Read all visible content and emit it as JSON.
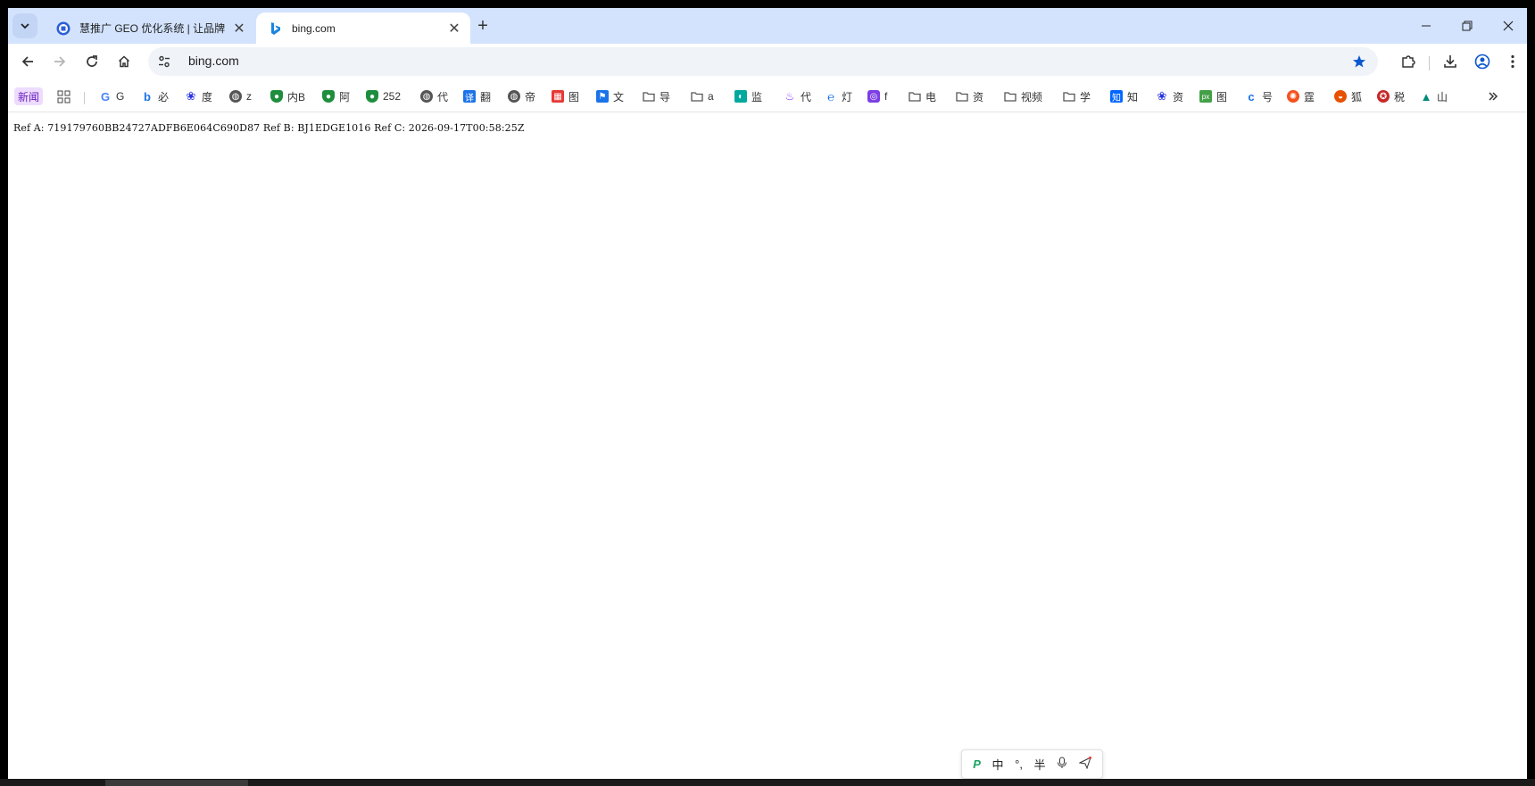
{
  "tabs": [
    {
      "title": "慧推广 GEO 优化系统 | 让品牌",
      "active": false
    },
    {
      "title": "bing.com",
      "active": true
    }
  ],
  "address": {
    "url": "bing.com"
  },
  "bookmarks": [
    {
      "label": "新闻",
      "icon": "news-badge"
    },
    {
      "label": "",
      "icon": "apps-grid-icon"
    },
    {
      "label": "G",
      "icon": "google-icon",
      "color": "#4285f4"
    },
    {
      "label": "必",
      "icon": "bing-icon",
      "color": "#1a73e8"
    },
    {
      "label": "度",
      "icon": "baidu-paw-icon",
      "color": "#2932e1"
    },
    {
      "label": "z",
      "icon": "globe-icon",
      "color": "#555555"
    },
    {
      "label": "内B",
      "icon": "green-shield-icon",
      "color": "#1e8e3e"
    },
    {
      "label": "阿",
      "icon": "green-shield-icon",
      "color": "#1e8e3e"
    },
    {
      "label": "252",
      "icon": "green-shield-icon",
      "color": "#1e8e3e"
    },
    {
      "label": "代",
      "icon": "globe-icon",
      "color": "#555555"
    },
    {
      "label": "翻",
      "icon": "translate-icon",
      "color": "#1a73e8"
    },
    {
      "label": "帝",
      "icon": "globe-icon",
      "color": "#555555"
    },
    {
      "label": "图",
      "icon": "image-red-icon",
      "color": "#e53935"
    },
    {
      "label": "文",
      "icon": "doc-blue-icon",
      "color": "#1a73e8"
    },
    {
      "label": "导",
      "icon": "folder-icon",
      "color": "#555555"
    },
    {
      "label": "a",
      "icon": "folder-icon",
      "color": "#555555"
    },
    {
      "label": "监",
      "icon": "monitor-teal-icon",
      "color": "#00a89d"
    },
    {
      "label": "代",
      "icon": "purple-drop-icon",
      "color": "#8e44ef"
    },
    {
      "label": "灯",
      "icon": "lamp-blue-icon",
      "color": "#1a73e8"
    },
    {
      "label": "f",
      "icon": "purple-ring-icon",
      "color": "#7b3fe4"
    },
    {
      "label": "电",
      "icon": "folder-icon",
      "color": "#555555"
    },
    {
      "label": "资",
      "icon": "folder-icon",
      "color": "#555555"
    },
    {
      "label": "视频",
      "icon": "folder-icon",
      "color": "#555555"
    },
    {
      "label": "学",
      "icon": "folder-icon",
      "color": "#555555"
    },
    {
      "label": "知",
      "icon": "zhihu-icon",
      "color": "#0066ff"
    },
    {
      "label": "资",
      "icon": "baidu-paw-icon",
      "color": "#2932e1"
    },
    {
      "label": "图",
      "icon": "px-green-icon",
      "color": "#43a047"
    },
    {
      "label": "号",
      "icon": "blue-c-icon",
      "color": "#1a73e8"
    },
    {
      "label": "霆",
      "icon": "orange-swirl-icon",
      "color": "#f4511e"
    },
    {
      "label": "狐",
      "icon": "fox-icon",
      "color": "#e65100"
    },
    {
      "label": "税",
      "icon": "emblem-icon",
      "color": "#c62828"
    },
    {
      "label": "山",
      "icon": "mountain-teal-icon",
      "color": "#00897b"
    }
  ],
  "content": {
    "reftext": "Ref A: 719179760BB24727ADFB6E064C690D87 Ref B: BJ1EDGE1016 Ref C: 2026-09-17T00:58:25Z"
  },
  "ime": {
    "items": [
      "中",
      "°,",
      "半"
    ]
  },
  "colors": {
    "tabstrip": "#d3e3fd",
    "accent": "#0b57d0"
  }
}
